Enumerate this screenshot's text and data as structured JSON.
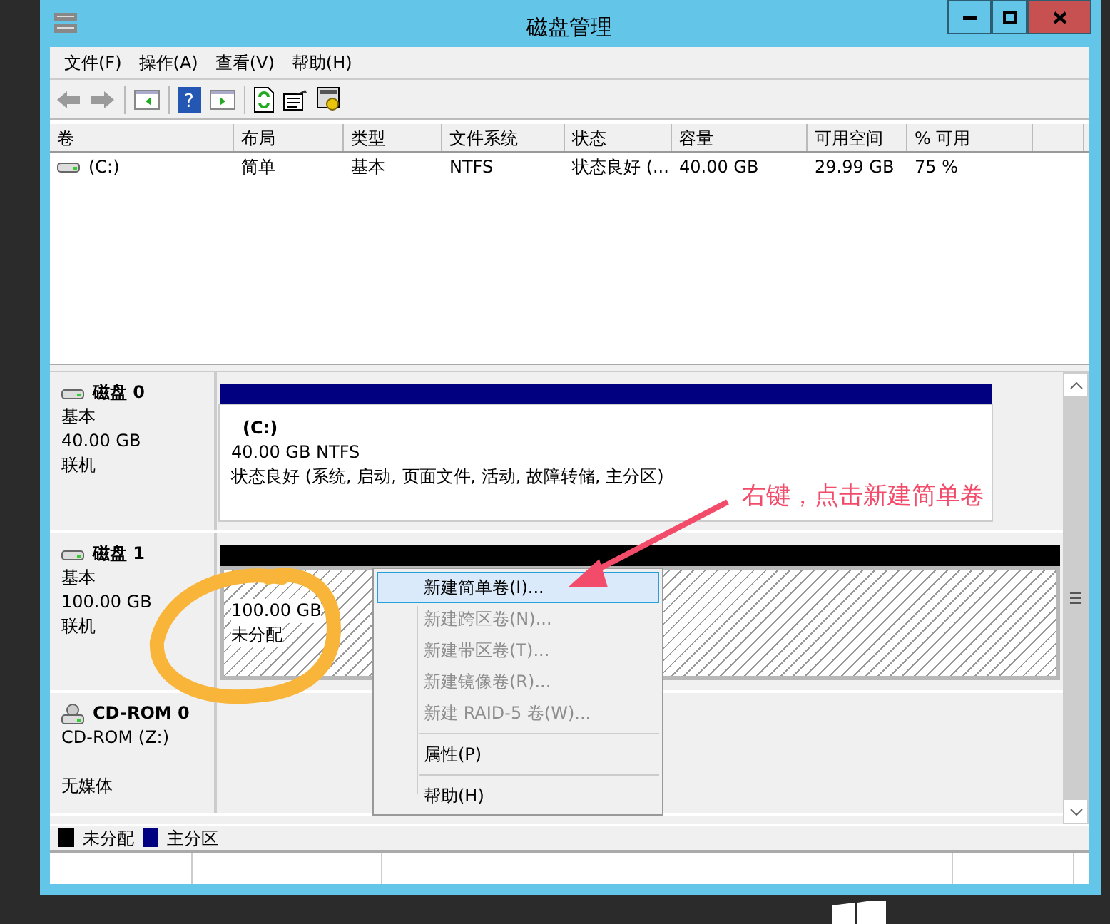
{
  "window": {
    "title": "磁盘管理"
  },
  "menu": [
    "文件(F)",
    "操作(A)",
    "查看(V)",
    "帮助(H)"
  ],
  "toolbar": {
    "help_glyph": "?"
  },
  "table": {
    "columns": [
      "卷",
      "布局",
      "类型",
      "文件系统",
      "状态",
      "容量",
      "可用空间",
      "% 可用"
    ],
    "rows": [
      [
        "(C:)",
        "简单",
        "基本",
        "NTFS",
        "状态良好 (...",
        "40.00 GB",
        "29.99 GB",
        "75 %"
      ]
    ]
  },
  "disks": [
    {
      "kind": "disk",
      "name": "磁盘 0",
      "type": "基本",
      "size": "40.00 GB",
      "status": "联机",
      "partitions": [
        {
          "kind": "primary",
          "name": "(C:)",
          "size": "40.00 GB NTFS",
          "status": "状态良好 (系统, 启动, 页面文件, 活动, 故障转储, 主分区)"
        }
      ]
    },
    {
      "kind": "disk",
      "name": "磁盘 1",
      "type": "基本",
      "size": "100.00 GB",
      "status": "联机",
      "partitions": [
        {
          "kind": "unallocated",
          "size": "100.00 GB",
          "status": "未分配"
        }
      ]
    },
    {
      "kind": "cdrom",
      "name": "CD-ROM 0",
      "type": "CD-ROM (Z:)",
      "status": "无媒体"
    }
  ],
  "context_menu": [
    {
      "label": "新建简单卷(I)...",
      "disabled": false,
      "selected": true
    },
    {
      "label": "新建跨区卷(N)...",
      "disabled": true,
      "selected": false
    },
    {
      "label": "新建带区卷(T)...",
      "disabled": true,
      "selected": false
    },
    {
      "label": "新建镜像卷(R)...",
      "disabled": true,
      "selected": false
    },
    {
      "label": "新建 RAID-5 卷(W)...",
      "disabled": true,
      "selected": false,
      "separator_after": true
    },
    {
      "label": "属性(P)",
      "disabled": false,
      "selected": false,
      "separator_after": true
    },
    {
      "label": "帮助(H)",
      "disabled": false,
      "selected": false
    }
  ],
  "legend": [
    {
      "label": "未分配",
      "color": "#000000"
    },
    {
      "label": "主分区",
      "color": "#000080"
    }
  ],
  "annotation": {
    "text": "右键，点击新建简单卷"
  }
}
